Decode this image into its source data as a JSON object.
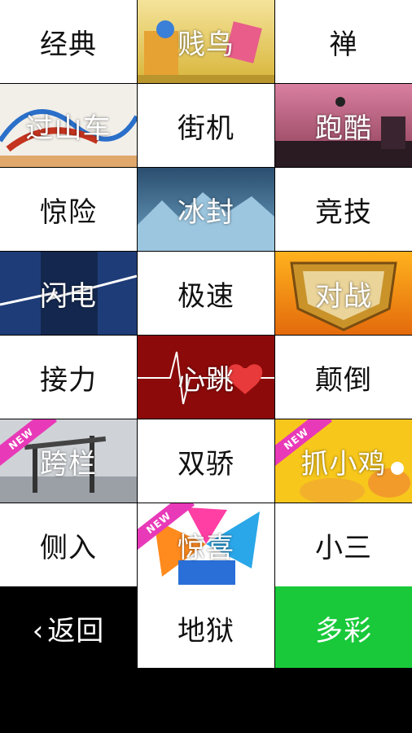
{
  "tiles": [
    {
      "label": "经典"
    },
    {
      "label": "贱鸟"
    },
    {
      "label": "禅"
    },
    {
      "label": "过山车"
    },
    {
      "label": "街机"
    },
    {
      "label": "跑酷"
    },
    {
      "label": "惊险"
    },
    {
      "label": "冰封"
    },
    {
      "label": "竞技"
    },
    {
      "label": "闪电"
    },
    {
      "label": "极速"
    },
    {
      "label": "对战"
    },
    {
      "label": "接力"
    },
    {
      "label": "心跳"
    },
    {
      "label": "颠倒"
    },
    {
      "label": "跨栏"
    },
    {
      "label": "双骄"
    },
    {
      "label": "抓小鸡"
    },
    {
      "label": "侧入"
    },
    {
      "label": "惊喜"
    },
    {
      "label": "小三"
    },
    {
      "label": "返回"
    },
    {
      "label": "地狱"
    },
    {
      "label": "多彩"
    }
  ],
  "badge": "NEW",
  "colors": {
    "accent_green": "#19c93a",
    "badge_pink": "#e83ab8"
  }
}
